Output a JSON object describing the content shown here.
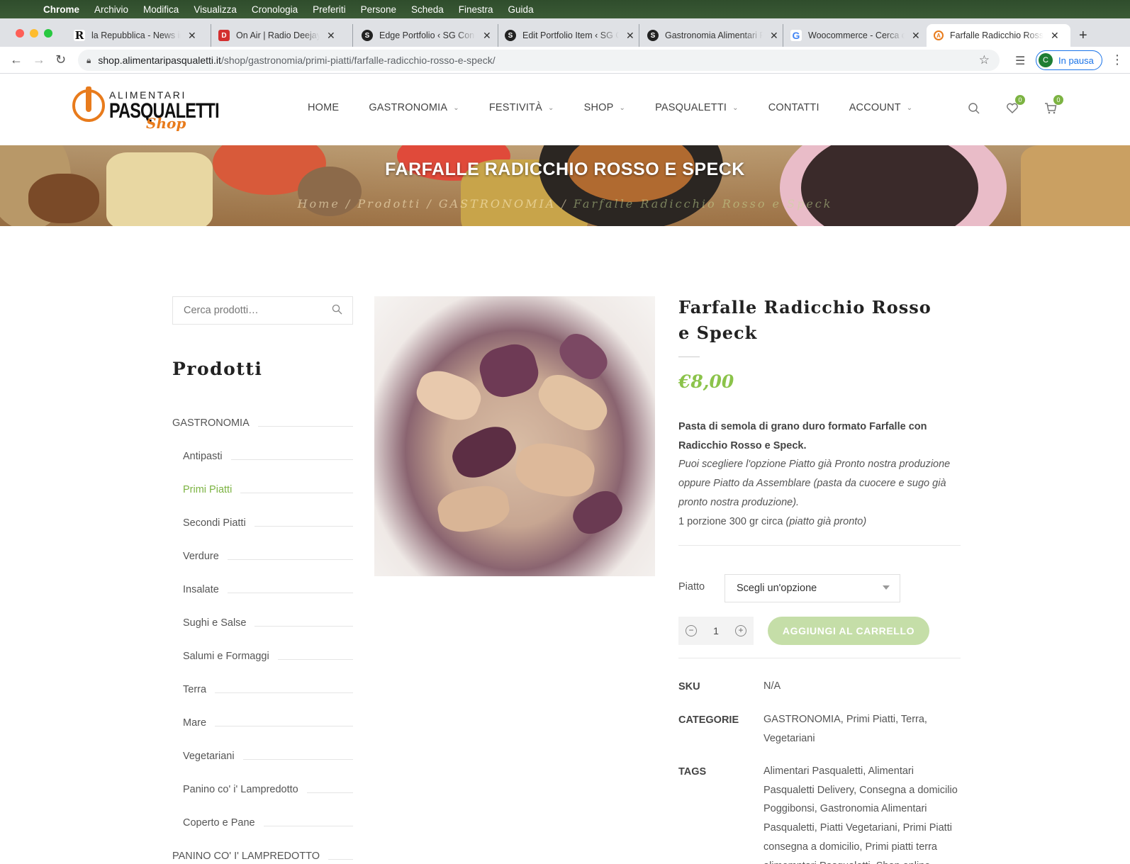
{
  "menubar": {
    "app": "Chrome",
    "items": [
      "Archivio",
      "Modifica",
      "Visualizza",
      "Cronologia",
      "Preferiti",
      "Persone",
      "Scheda",
      "Finestra",
      "Guida"
    ]
  },
  "tabs": [
    {
      "title": "la Repubblica - News in",
      "fav": "R",
      "color": "#111"
    },
    {
      "title": "On Air | Radio Deejay",
      "fav": "D",
      "color": "#d32f2f"
    },
    {
      "title": "Edge Portfolio ‹ SG Con",
      "fav": "S",
      "color": "#222"
    },
    {
      "title": "Edit Portfolio Item ‹ SG C",
      "fav": "S",
      "color": "#222"
    },
    {
      "title": "Gastronomia Alimentari P",
      "fav": "S",
      "color": "#222"
    },
    {
      "title": "Woocommerce - Cerca c",
      "fav": "G",
      "color": "#4285f4"
    },
    {
      "title": "Farfalle Radicchio Rosso",
      "fav": "A",
      "color": "#e87b1c"
    }
  ],
  "address": {
    "host": "shop.alimentaripasqualetti.it",
    "path": "/shop/gastronomia/primi-piatti/farfalle-radicchio-rosso-e-speck/"
  },
  "profile": {
    "initial": "C",
    "status": "In pausa"
  },
  "logo": {
    "line1": "ALIMENTARI",
    "line2": "PASQUALETTI",
    "line3": "Shop"
  },
  "nav": [
    "HOME",
    "GASTRONOMIA",
    "FESTIVITÀ",
    "SHOP",
    "PASQUALETTI",
    "CONTATTI",
    "ACCOUNT"
  ],
  "wishlist_count": "0",
  "cart_count": "0",
  "banner": {
    "title": "FARFALLE RADICCHIO ROSSO E SPECK",
    "crumbs": [
      "Home",
      "Prodotti",
      "GASTRONOMIA",
      "Farfalle Radicchio Rosso e Speck"
    ]
  },
  "sidebar": {
    "search_placeholder": "Cerca prodotti…",
    "heading": "Prodotti",
    "categories": [
      {
        "label": "GASTRONOMIA"
      },
      {
        "label": "Antipasti"
      },
      {
        "label": "Primi Piatti"
      },
      {
        "label": "Secondi Piatti"
      },
      {
        "label": "Verdure"
      },
      {
        "label": "Insalate"
      },
      {
        "label": "Sughi e Salse"
      },
      {
        "label": "Salumi e Formaggi"
      },
      {
        "label": "Terra"
      },
      {
        "label": "Mare"
      },
      {
        "label": "Vegetariani"
      },
      {
        "label": "Panino co' i' Lampredotto"
      },
      {
        "label": "Coperto e Pane"
      },
      {
        "label": "PANINO CO' I' LAMPREDOTTO"
      }
    ]
  },
  "product": {
    "title": "Farfalle Radicchio Rosso e Speck",
    "price": "€8,00",
    "desc_bold": "Pasta di semola di grano duro formato Farfalle con Radicchio Rosso e Speck.",
    "desc_italic": "Puoi scegliere l'opzione Piatto già Pronto nostra produzione oppure Piatto da Assemblare (pasta da cuocere e sugo già pronto nostra produzione).",
    "desc_portion": "1 porzione 300 gr circa",
    "desc_portion_note": "(piatto già pronto)",
    "option_label": "Piatto",
    "option_value": "Scegli un'opzione",
    "quantity": "1",
    "add_to_cart": "AGGIUNGI AL CARRELLO",
    "meta": {
      "sku_label": "SKU",
      "sku": "N/A",
      "cat_label": "CATEGORIE",
      "categories": "GASTRONOMIA, Primi Piatti, Terra, Vegetariani",
      "tags_label": "TAGS",
      "tags": "Alimentari Pasqualetti, Alimentari Pasqualetti Delivery, Consegna a domicilio Poggibonsi, Gastronomia Alimentari Pasqualetti, Piatti Vegetariani, Primi Piatti consegna a domicilio, Primi piatti terra alimemntari Pasqualetti, Shop online"
    }
  },
  "colors": {
    "accent": "#7cb342",
    "price": "#8bc34a",
    "logo": "#e87b1c"
  }
}
